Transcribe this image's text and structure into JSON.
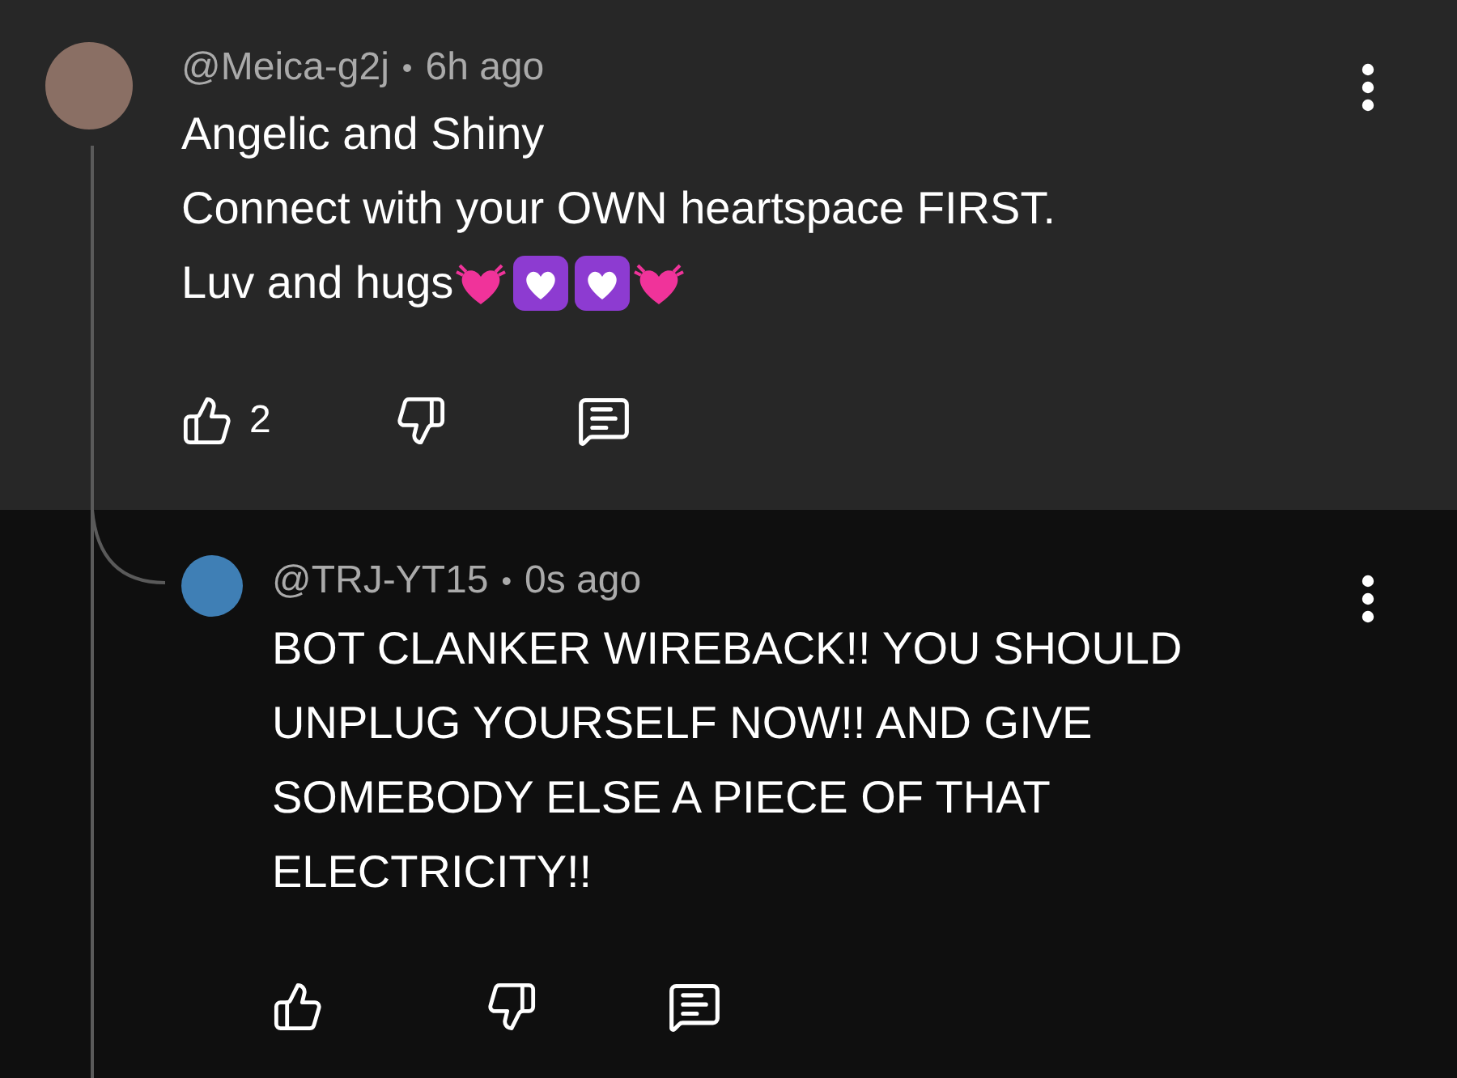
{
  "comments": [
    {
      "kind": "comment",
      "author": "@Meica-g2j",
      "separator": "•",
      "time": "6h ago",
      "lines": [
        "Angelic and Shiny",
        "Connect with your OWN heartspace FIRST.",
        "Luv and hugs"
      ],
      "emojis": [
        {
          "kind": "beating-heart"
        },
        {
          "kind": "heart-square"
        },
        {
          "kind": "heart-square"
        },
        {
          "kind": "beating-heart"
        }
      ],
      "likes": "2"
    },
    {
      "kind": "reply",
      "author": "@TRJ-YT15",
      "separator": "•",
      "time": "0s ago",
      "lines": [
        "BOT CLANKER WIREBACK!! YOU SHOULD UNPLUG YOURSELF NOW!! AND GIVE SOMEBODY ELSE A PIECE OF THAT ELECTRICITY!!"
      ]
    }
  ]
}
